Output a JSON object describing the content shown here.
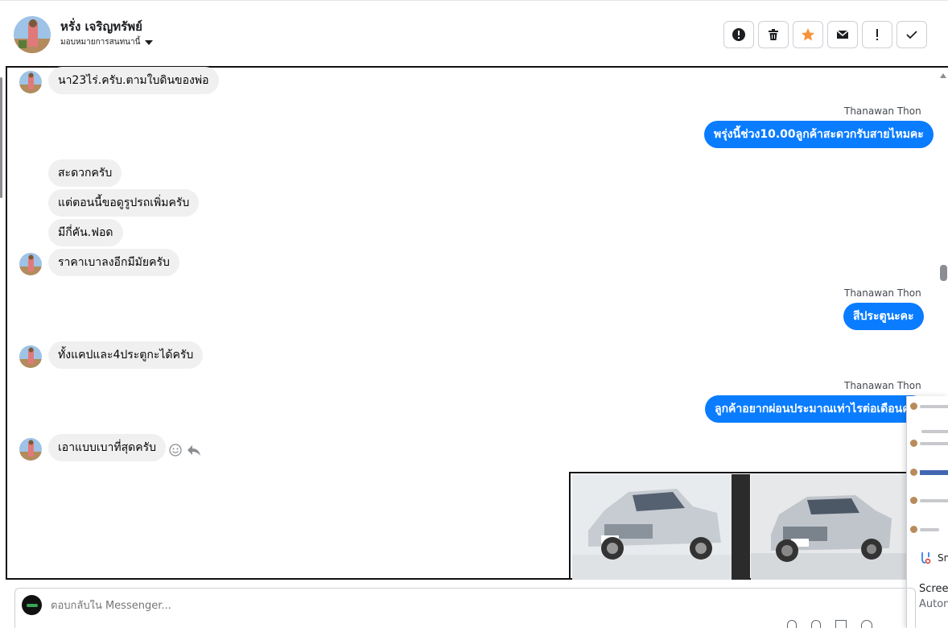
{
  "header": {
    "contact_name": "หรั่ง เจริญทรัพย์",
    "assign_label": "มอบหมายการสนทนานี้",
    "toolbar": [
      {
        "name": "report-spam",
        "icon": "alert-circle-icon"
      },
      {
        "name": "delete",
        "icon": "trash-icon"
      },
      {
        "name": "star",
        "icon": "star-icon",
        "color": "#f7923b"
      },
      {
        "name": "mark-unread",
        "icon": "envelope-icon"
      },
      {
        "name": "mark-important",
        "icon": "exclamation-icon"
      },
      {
        "name": "mark-done",
        "icon": "check-icon"
      }
    ]
  },
  "messages": {
    "m1": "นา23ไร่.ครับ.ตามใบดินของพ่อ",
    "sender1": "Thanawan Thon",
    "m2": "พรุ่งนี้ช่วง10.00ลูกค้าสะดวกรับสายไหมคะ",
    "m3": "สะดวกครับ",
    "m4": "แต่ตอนนี้ขอดูรูปรถเพิ่มครับ",
    "m5": "มีกี่คัน.ฟอด",
    "m6": "ราคาเบาลงอีกมีมัยครับ",
    "sender2": "Thanawan Thon",
    "m7": "สีประตูนะคะ",
    "m8": "ทั้งแคปและ4ประตูกะได้ครับ",
    "sender3": "Thanawan Thon",
    "m9": "ลูกค้าอยากผ่อนประมาณเท่าไรต่อเดือนคะ",
    "m10": "เอาแบบเบาที่สุดครับ"
  },
  "side_panel": {
    "snip_label": "Sn",
    "screen_label": "Screer",
    "auto_label": "Auton"
  },
  "composer": {
    "placeholder": "ตอบกลับใน Messenger..."
  },
  "colors": {
    "outgoing": "#0a7cff",
    "incoming": "#f0f0f0",
    "accent_star": "#f7923b"
  }
}
